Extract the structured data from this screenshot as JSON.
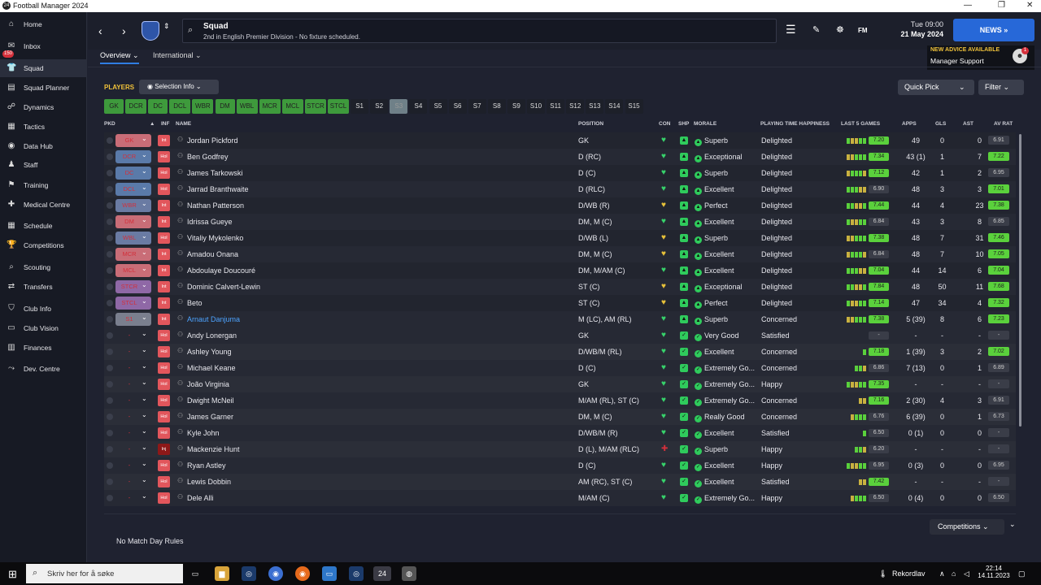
{
  "window": {
    "title": "Football Manager 2024",
    "minimize": "—",
    "restore": "❐",
    "close": "✕"
  },
  "sidebar": {
    "inbox_badge": "150",
    "items": [
      {
        "label": "Home",
        "icon": "home-icon",
        "glyph": "⌂"
      },
      {
        "label": "Inbox",
        "icon": "inbox-icon",
        "glyph": "✉"
      },
      {
        "label": "Squad",
        "icon": "shirt-icon",
        "glyph": "👕"
      },
      {
        "label": "Squad Planner",
        "icon": "planner-icon",
        "glyph": "▤"
      },
      {
        "label": "Dynamics",
        "icon": "dynamics-icon",
        "glyph": "☍"
      },
      {
        "label": "Tactics",
        "icon": "tactics-icon",
        "glyph": "▦"
      },
      {
        "label": "Data Hub",
        "icon": "data-hub-icon",
        "glyph": "◉"
      },
      {
        "label": "Staff",
        "icon": "staff-icon",
        "glyph": "♟"
      },
      {
        "label": "Training",
        "icon": "training-icon",
        "glyph": "⚑"
      },
      {
        "label": "Medical Centre",
        "icon": "medical-icon",
        "glyph": "✚"
      },
      {
        "label": "Schedule",
        "icon": "schedule-icon",
        "glyph": "▦"
      },
      {
        "label": "Competitions",
        "icon": "trophy-icon",
        "glyph": "🏆"
      },
      {
        "label": "Scouting",
        "icon": "scouting-icon",
        "glyph": "⌕"
      },
      {
        "label": "Transfers",
        "icon": "transfers-icon",
        "glyph": "⇄"
      },
      {
        "label": "Club Info",
        "icon": "shield-icon",
        "glyph": "⛉"
      },
      {
        "label": "Club Vision",
        "icon": "vision-icon",
        "glyph": "▭"
      },
      {
        "label": "Finances",
        "icon": "finances-icon",
        "glyph": "▥"
      },
      {
        "label": "Dev. Centre",
        "icon": "dev-centre-icon",
        "glyph": "⤳"
      }
    ]
  },
  "header": {
    "title": "Squad",
    "subtitle": "2nd in English Premier Division - No fixture scheduled.",
    "day": "Tue 09:00",
    "date": "21 May 2024",
    "news": "NEWS »",
    "fm": "FM",
    "advice_title": "NEW ADVICE AVAILABLE",
    "advice_sub": "Manager Support",
    "advice_count": "1"
  },
  "tabs": [
    {
      "label": "Overview ⌄"
    },
    {
      "label": "International ⌄"
    }
  ],
  "toolbar": {
    "players": "PLAYERS",
    "selection_info": "◉  Selection Info  ⌄",
    "quick_pick": "Quick Pick",
    "quick_pick_chev": "⌄",
    "filter": "Filter  ⌄"
  },
  "position_buttons": [
    "GK",
    "DCR",
    "DC",
    "DCL",
    "WBR",
    "DM",
    "WBL",
    "MCR",
    "MCL",
    "STCR",
    "STCL",
    "S1",
    "S2",
    "S3",
    "S4",
    "S5",
    "S6",
    "S7",
    "S8",
    "S9",
    "S10",
    "S11",
    "S12",
    "S13",
    "S14",
    "S15"
  ],
  "columns": {
    "pkd": "PKD",
    "inf": "INF",
    "name": "NAME",
    "position": "POSITION",
    "con": "CON",
    "shp": "SHP",
    "morale": "MORALE",
    "pth": "PLAYING TIME HAPPINESS",
    "last5": "LAST 5 GAMES",
    "apps": "APPS",
    "gls": "GLS",
    "ast": "AST",
    "avrat": "AV RAT"
  },
  "players": [
    {
      "pos": "GK",
      "inf": "Int",
      "name": "Jordan Pickford",
      "position": "GK",
      "morale": "Superb",
      "pth": "Delighted",
      "l5": "7.20",
      "apps": "49",
      "gls": "0",
      "ast": "0",
      "av": "6.91"
    },
    {
      "pos": "DCR",
      "inf": "Hol",
      "name": "Ben Godfrey",
      "position": "D (RC)",
      "morale": "Exceptional",
      "pth": "Delighted",
      "l5": "7.34",
      "apps": "43 (1)",
      "gls": "1",
      "ast": "7",
      "av": "7.22"
    },
    {
      "pos": "DC",
      "inf": "Hol",
      "name": "James Tarkowski",
      "position": "D (C)",
      "morale": "Superb",
      "pth": "Delighted",
      "l5": "7.12",
      "apps": "42",
      "gls": "1",
      "ast": "2",
      "av": "6.95"
    },
    {
      "pos": "DCL",
      "inf": "Hol",
      "name": "Jarrad Branthwaite",
      "position": "D (RLC)",
      "morale": "Excellent",
      "pth": "Delighted",
      "l5": "6.90",
      "apps": "48",
      "gls": "3",
      "ast": "3",
      "av": "7.01"
    },
    {
      "pos": "WBR",
      "inf": "Int",
      "name": "Nathan Patterson",
      "position": "D/WB (R)",
      "morale": "Perfect",
      "pth": "Delighted",
      "l5": "7.44",
      "apps": "44",
      "gls": "4",
      "ast": "23",
      "av": "7.38"
    },
    {
      "pos": "DM",
      "inf": "Int",
      "name": "Idrissa Gueye",
      "position": "DM, M (C)",
      "morale": "Excellent",
      "pth": "Delighted",
      "l5": "6.84",
      "apps": "43",
      "gls": "3",
      "ast": "8",
      "av": "6.85"
    },
    {
      "pos": "WBL",
      "inf": "Hol",
      "name": "Vitaliy Mykolenko",
      "position": "D/WB (L)",
      "morale": "Superb",
      "pth": "Delighted",
      "l5": "7.38",
      "apps": "48",
      "gls": "7",
      "ast": "31",
      "av": "7.46"
    },
    {
      "pos": "MCR",
      "inf": "Int",
      "name": "Amadou Onana",
      "position": "DM, M (C)",
      "morale": "Excellent",
      "pth": "Delighted",
      "l5": "6.84",
      "apps": "48",
      "gls": "7",
      "ast": "10",
      "av": "7.05"
    },
    {
      "pos": "MCL",
      "inf": "Int",
      "name": "Abdoulaye Doucouré",
      "position": "DM, M/AM (C)",
      "morale": "Excellent",
      "pth": "Delighted",
      "l5": "7.04",
      "apps": "44",
      "gls": "14",
      "ast": "6",
      "av": "7.04"
    },
    {
      "pos": "STCR",
      "inf": "Int",
      "name": "Dominic Calvert-Lewin",
      "position": "ST (C)",
      "morale": "Exceptional",
      "pth": "Delighted",
      "l5": "7.84",
      "apps": "48",
      "gls": "50",
      "ast": "11",
      "av": "7.68"
    },
    {
      "pos": "STCL",
      "inf": "Int",
      "name": "Beto",
      "position": "ST (C)",
      "morale": "Perfect",
      "pth": "Delighted",
      "l5": "7.14",
      "apps": "47",
      "gls": "34",
      "ast": "4",
      "av": "7.32"
    },
    {
      "pos": "S1",
      "inf": "Int",
      "name": "Arnaut Danjuma",
      "position": "M (LC), AM (RL)",
      "morale": "Superb",
      "pth": "Concerned",
      "l5": "7.38",
      "apps": "5 (39)",
      "gls": "8",
      "ast": "6",
      "av": "7.23"
    },
    {
      "pos": "-",
      "inf": "Hol",
      "name": "Andy Lonergan",
      "position": "GK",
      "morale": "Very Good",
      "pth": "Satisfied",
      "l5": "-",
      "apps": "-",
      "gls": "-",
      "ast": "-",
      "av": "-"
    },
    {
      "pos": "-",
      "inf": "Hol",
      "name": "Ashley Young",
      "position": "D/WB/M (RL)",
      "morale": "Excellent",
      "pth": "Concerned",
      "l5": "7.18",
      "apps": "1 (39)",
      "gls": "3",
      "ast": "2",
      "av": "7.02"
    },
    {
      "pos": "-",
      "inf": "Hol",
      "name": "Michael Keane",
      "position": "D (C)",
      "morale": "Extremely Go...",
      "pth": "Concerned",
      "l5": "6.86",
      "apps": "7 (13)",
      "gls": "0",
      "ast": "1",
      "av": "6.89"
    },
    {
      "pos": "-",
      "inf": "Hol",
      "name": "João Virginia",
      "position": "GK",
      "morale": "Extremely Go...",
      "pth": "Happy",
      "l5": "7.35",
      "apps": "-",
      "gls": "-",
      "ast": "-",
      "av": "-"
    },
    {
      "pos": "-",
      "inf": "Hol",
      "name": "Dwight McNeil",
      "position": "M/AM (RL), ST (C)",
      "morale": "Extremely Go...",
      "pth": "Concerned",
      "l5": "7.16",
      "apps": "2 (30)",
      "gls": "4",
      "ast": "3",
      "av": "6.91"
    },
    {
      "pos": "-",
      "inf": "Hol",
      "name": "James Garner",
      "position": "DM, M (C)",
      "morale": "Really Good",
      "pth": "Concerned",
      "l5": "6.76",
      "apps": "6 (39)",
      "gls": "0",
      "ast": "1",
      "av": "6.73"
    },
    {
      "pos": "-",
      "inf": "Hol",
      "name": "Kyle John",
      "position": "D/WB/M (R)",
      "morale": "Excellent",
      "pth": "Satisfied",
      "l5": "6.50",
      "apps": "0 (1)",
      "gls": "0",
      "ast": "0",
      "av": "-"
    },
    {
      "pos": "-",
      "inf": "Inj",
      "name": "Mackenzie Hunt",
      "position": "D (L), M/AM (RLC)",
      "morale": "Superb",
      "pth": "Happy",
      "l5": "6.20",
      "apps": "-",
      "gls": "-",
      "ast": "-",
      "av": "-"
    },
    {
      "pos": "-",
      "inf": "Hol",
      "name": "Ryan Astley",
      "position": "D (C)",
      "morale": "Excellent",
      "pth": "Happy",
      "l5": "6.95",
      "apps": "0 (3)",
      "gls": "0",
      "ast": "0",
      "av": "6.95"
    },
    {
      "pos": "-",
      "inf": "Hol",
      "name": "Lewis Dobbin",
      "position": "AM (RC), ST (C)",
      "morale": "Excellent",
      "pth": "Satisfied",
      "l5": "7.42",
      "apps": "-",
      "gls": "-",
      "ast": "-",
      "av": "-"
    },
    {
      "pos": "-",
      "inf": "Hol",
      "name": "Dele Alli",
      "position": "M/AM (C)",
      "morale": "Extremely Go...",
      "pth": "Happy",
      "l5": "6.50",
      "apps": "0 (4)",
      "gls": "0",
      "ast": "0",
      "av": "6.50"
    }
  ],
  "footer": {
    "competitions": "Competitions  ⌄",
    "no_rules": "No Match Day Rules"
  },
  "taskbar": {
    "search_placeholder": "Skriv her for å søke",
    "weather": "Rekordlav",
    "time": "22:14",
    "date": "14.11.2023"
  },
  "colors": {
    "accent": "#2768d8",
    "green": "#3e9a3c",
    "gold": "#f0c23a",
    "rating_green": "#5ad13c",
    "rating_gray": "#3a3d48"
  }
}
